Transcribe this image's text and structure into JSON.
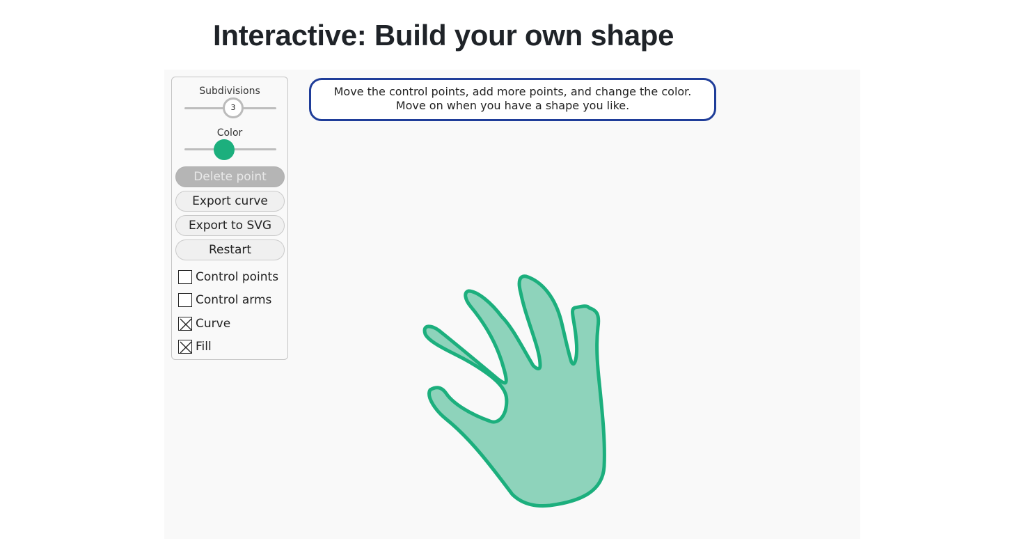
{
  "page": {
    "title": "Interactive: Build your own shape"
  },
  "controls": {
    "subdivisions_label": "Subdivisions",
    "subdivisions_value": "3",
    "color_label": "Color",
    "color_value": "#1caf7d",
    "buttons": {
      "delete_point": "Delete point",
      "export_curve": "Export curve",
      "export_svg": "Export to SVG",
      "restart": "Restart"
    },
    "checkboxes": [
      {
        "label": "Control points",
        "checked": false
      },
      {
        "label": "Control arms",
        "checked": false
      },
      {
        "label": "Curve",
        "checked": true
      },
      {
        "label": "Fill",
        "checked": true
      }
    ]
  },
  "instructions": {
    "line1": "Move the control points, add more points, and change the color.",
    "line2": "Move on when you have a shape you like."
  },
  "shape": {
    "fill": "#8ed3bb",
    "stroke": "#1caf7d"
  }
}
